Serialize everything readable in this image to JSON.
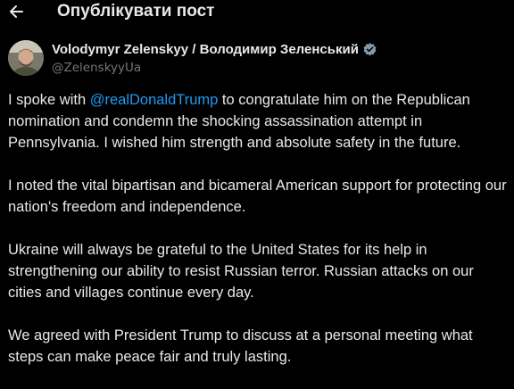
{
  "header": {
    "back_icon": "arrow-left-icon",
    "title": "Опублікувати пост"
  },
  "author": {
    "name": "Volodymyr Zelenskyy / Володимир Зеленський",
    "handle": "@ZelenskyyUa",
    "verified_icon": "verified-badge-icon",
    "verified_color": "#829aab"
  },
  "tweet": {
    "p1_before": "I spoke with ",
    "p1_mention": "@realDonaldTrump",
    "p1_after": " to congratulate him on the Republican nomination and condemn the shocking assassination attempt in Pennsylvania. I wished him strength and absolute safety in the future.",
    "p2": "I noted the vital bipartisan and bicameral American support for protecting our nation's freedom and independence.",
    "p3": "Ukraine will always be grateful to the United States for its help in strengthening our ability to resist Russian terror. Russian attacks on our cities and villages continue every day.",
    "p4": "We agreed with President Trump to discuss at a personal meeting what steps can make peace fair and truly lasting."
  },
  "colors": {
    "background": "#000000",
    "text": "#e7e9ea",
    "secondary": "#71767b",
    "link": "#1d9bf0"
  }
}
